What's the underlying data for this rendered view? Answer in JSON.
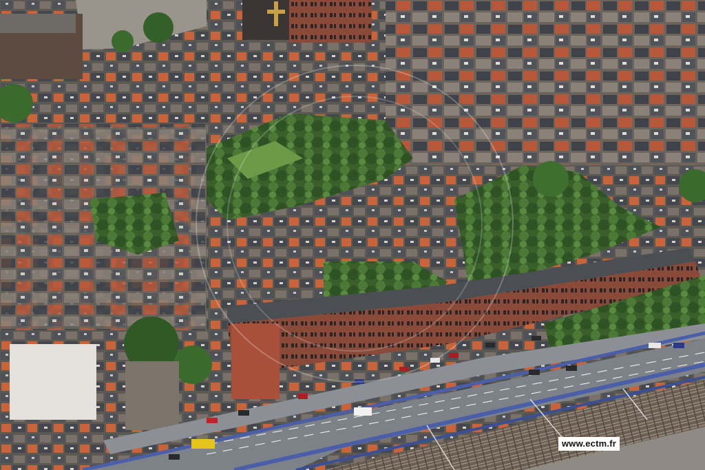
{
  "photo": {
    "watermark_text": "www.ectm.fr",
    "colors": {
      "roof_slate": "#4e5258",
      "roof_tile": "#c8643c",
      "vegetation": "#3f6b2f",
      "road": "#7d8289",
      "railing": "#4a5fa8",
      "rail_track": "#6b5e52"
    }
  }
}
